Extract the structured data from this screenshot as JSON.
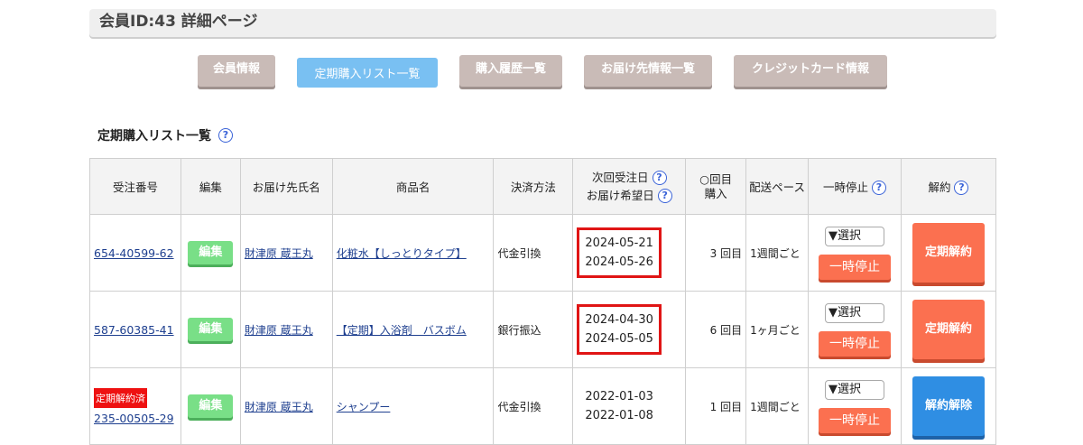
{
  "header": {
    "title": "会員ID:43 詳細ページ"
  },
  "tabs": [
    {
      "label": "会員情報",
      "active": false
    },
    {
      "label": "定期購入リスト一覧",
      "active": true
    },
    {
      "label": "購入履歴一覧",
      "active": false
    },
    {
      "label": "お届け先情報一覧",
      "active": false
    },
    {
      "label": "クレジットカード情報",
      "active": false
    }
  ],
  "section": {
    "title": "定期購入リスト一覧",
    "help_icon": "question-circle-icon"
  },
  "table": {
    "headers": {
      "order": "受注番号",
      "edit": "編集",
      "name": "お届け先氏名",
      "item": "商品名",
      "payment": "決済方法",
      "next_order": "次回受注日",
      "delivery": "お届け希望日",
      "count_line1": "○回目",
      "count_line2": "購入",
      "shipping": "配送ペース",
      "pause": "一時停止",
      "cancel": "解約"
    },
    "rows": [
      {
        "badge": "",
        "order_no": "654-40599-62",
        "edit_label": "編集",
        "name": "財津原 蔵王丸",
        "item": "化粧水【しっとりタイプ】",
        "payment": "代金引換",
        "next_order": "2024-05-21",
        "delivery": "2024-05-26",
        "count": "3 回目",
        "shipping": "1週間ごと",
        "select": "▼選択",
        "pause_label": "一時停止",
        "cancel_label": "定期解約",
        "highlighted": true
      },
      {
        "badge": "",
        "order_no": "587-60385-41",
        "edit_label": "編集",
        "name": "財津原 蔵王丸",
        "item": "【定期】入浴剤　バスボム",
        "payment": "銀行振込",
        "next_order": "2024-04-30",
        "delivery": "2024-05-05",
        "count": "6 回目",
        "shipping": "1ヶ月ごと",
        "select": "▼選択",
        "pause_label": "一時停止",
        "cancel_label": "定期解約",
        "highlighted": true
      },
      {
        "badge": "定期解約済",
        "order_no": "235-00505-29",
        "edit_label": "編集",
        "name": "財津原 蔵王丸",
        "item": "シャンプー",
        "payment": "代金引換",
        "next_order": "2022-01-03",
        "delivery": "2022-01-08",
        "count": "1 回目",
        "shipping": "1週間ごと",
        "select": "▼選択",
        "pause_label": "一時停止",
        "cancel_label": "解約解除",
        "highlighted": false
      }
    ]
  },
  "colors": {
    "highlight_border": "#e01515",
    "tab_active": "#79c0f2",
    "tab_inactive": "#c9bbb7",
    "edit_button": "#79df87",
    "cancel_button": "#fb7050",
    "release_button": "#2f8ee3"
  }
}
